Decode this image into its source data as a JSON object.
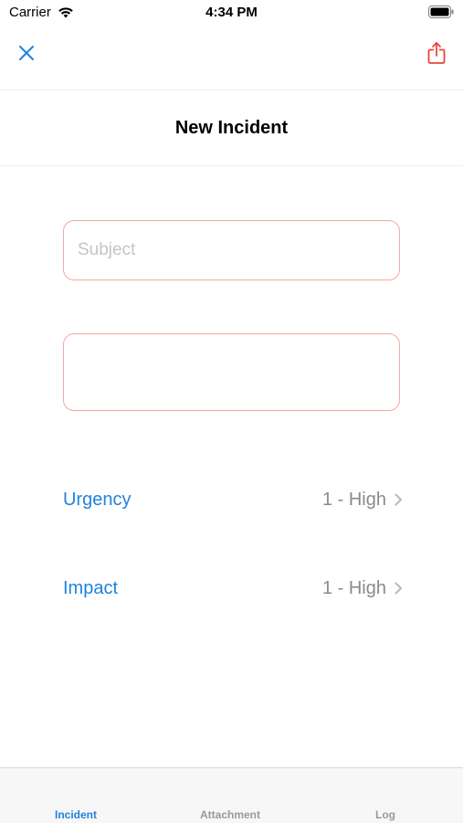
{
  "status_bar": {
    "carrier": "Carrier",
    "time": "4:34 PM"
  },
  "nav": {
    "close_icon": "close-icon",
    "share_icon": "share-icon"
  },
  "title": "New Incident",
  "form": {
    "subject": {
      "placeholder": "Subject",
      "value": ""
    },
    "description": {
      "value": ""
    },
    "urgency": {
      "label": "Urgency",
      "value": "1 - High"
    },
    "impact": {
      "label": "Impact",
      "value": "1 - High"
    }
  },
  "tabs": [
    {
      "label": "Incident",
      "active": true
    },
    {
      "label": "Attachment",
      "active": false
    },
    {
      "label": "Log",
      "active": false
    }
  ],
  "colors": {
    "accent": "#1e83dd",
    "share": "#e8453c",
    "input_border": "#f2a8a3",
    "value_gray": "#8a8a8e"
  }
}
